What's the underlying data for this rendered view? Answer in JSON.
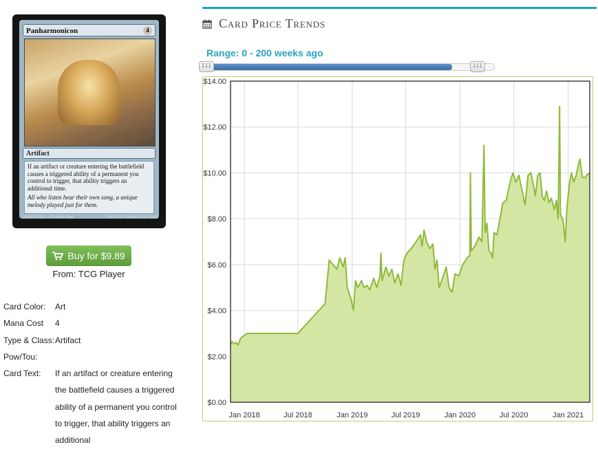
{
  "card": {
    "name": "Panharmonicon",
    "mana_symbol": "4",
    "type_line": "Artifact",
    "rules_text": "If an artifact or creature entering the battlefield causes a triggered ability of a permanent you control to trigger, that ability triggers an additional time.",
    "flavor_text": "All who listen hear their own song, a unique melody played just for them.",
    "collector_line": "226/264 R  KLD · EN  Volkan Baga",
    "copyright": "™ & © 2016 Wizards of the Coast"
  },
  "buy": {
    "label": "Buy for $9.89",
    "from": "From: TCG Player"
  },
  "info": [
    {
      "key": "Card Color:",
      "value": "Art"
    },
    {
      "key": "Mana Cost",
      "value": "4"
    },
    {
      "key": "Type & Class:",
      "value": "Artifact"
    },
    {
      "key": "Pow/Tou:",
      "value": ""
    },
    {
      "key": "Card Text:",
      "value": "If an artifact or creature entering the battlefield causes a triggered ability of a permanent you control to trigger, that ability triggers an additional"
    }
  ],
  "section": {
    "title": "Card Price Trends",
    "icon": "calendar-icon",
    "accent": "#19a6b6"
  },
  "range": {
    "label": "Range: 0 - 200 weeks ago",
    "low": 0,
    "high": 200,
    "max": 200
  },
  "chart_data": {
    "type": "area",
    "title": "",
    "xlabel": "",
    "ylabel": "",
    "ylim": [
      0,
      14
    ],
    "yticks": [
      0,
      2,
      4,
      6,
      8,
      10,
      12,
      14
    ],
    "ytick_labels": [
      "$0.00",
      "$2.00",
      "$4.00",
      "$6.00",
      "$8.00",
      "$10.00",
      "$12.00",
      "$14.00"
    ],
    "xlim": [
      "2017-11-15",
      "2021-03-15"
    ],
    "xticks": [
      "2018-01-01",
      "2018-07-01",
      "2019-01-01",
      "2019-07-01",
      "2020-01-01",
      "2020-07-01",
      "2021-01-01"
    ],
    "xtick_labels": [
      "Jan 2018",
      "Jul 2018",
      "Jan 2019",
      "Jul 2019",
      "Jan 2020",
      "Jul 2020",
      "Jan 2021"
    ],
    "grid": true,
    "colors": {
      "line": "#8fb93a",
      "fill": "#d4e6a3"
    },
    "series": [
      {
        "name": "",
        "points": [
          [
            "2017-11-15",
            2.5
          ],
          [
            "2017-11-20",
            2.65
          ],
          [
            "2017-11-27",
            2.55
          ],
          [
            "2017-12-04",
            2.6
          ],
          [
            "2017-12-10",
            2.5
          ],
          [
            "2017-12-20",
            2.8
          ],
          [
            "2018-01-10",
            3.0
          ],
          [
            "2018-04-15",
            3.0
          ],
          [
            "2018-05-05",
            3.0
          ],
          [
            "2018-07-01",
            3.0
          ],
          [
            "2018-10-01",
            4.3
          ],
          [
            "2018-10-15",
            6.2
          ],
          [
            "2018-11-10",
            5.8
          ],
          [
            "2018-11-20",
            6.3
          ],
          [
            "2018-12-01",
            5.9
          ],
          [
            "2018-12-08",
            6.3
          ],
          [
            "2018-12-15",
            5.0
          ],
          [
            "2018-12-28",
            4.5
          ],
          [
            "2019-01-05",
            4.0
          ],
          [
            "2019-01-12",
            5.3
          ],
          [
            "2019-01-20",
            5.0
          ],
          [
            "2019-02-01",
            5.3
          ],
          [
            "2019-02-10",
            5.0
          ],
          [
            "2019-02-20",
            5.1
          ],
          [
            "2019-03-01",
            4.9
          ],
          [
            "2019-03-15",
            5.4
          ],
          [
            "2019-03-25",
            5.0
          ],
          [
            "2019-04-05",
            5.5
          ],
          [
            "2019-04-08",
            6.5
          ],
          [
            "2019-04-12",
            5.3
          ],
          [
            "2019-04-25",
            5.9
          ],
          [
            "2019-05-05",
            5.5
          ],
          [
            "2019-05-15",
            5.8
          ],
          [
            "2019-05-25",
            5.2
          ],
          [
            "2019-06-05",
            5.6
          ],
          [
            "2019-06-15",
            5.1
          ],
          [
            "2019-06-25",
            6.2
          ],
          [
            "2019-07-05",
            6.5
          ],
          [
            "2019-07-20",
            6.7
          ],
          [
            "2019-08-05",
            7.0
          ],
          [
            "2019-08-20",
            7.3
          ],
          [
            "2019-08-25",
            6.8
          ],
          [
            "2019-09-01",
            7.5
          ],
          [
            "2019-09-10",
            7.0
          ],
          [
            "2019-09-20",
            6.7
          ],
          [
            "2019-10-01",
            6.9
          ],
          [
            "2019-10-08",
            5.8
          ],
          [
            "2019-10-15",
            6.2
          ],
          [
            "2019-10-22",
            5.0
          ],
          [
            "2019-11-05",
            5.5
          ],
          [
            "2019-11-15",
            5.9
          ],
          [
            "2019-11-25",
            5.0
          ],
          [
            "2019-12-05",
            4.8
          ],
          [
            "2019-12-15",
            5.6
          ],
          [
            "2019-12-28",
            5.5
          ],
          [
            "2020-01-10",
            6.0
          ],
          [
            "2020-01-25",
            6.3
          ],
          [
            "2020-02-03",
            6.4
          ],
          [
            "2020-02-05",
            10.0
          ],
          [
            "2020-02-08",
            6.6
          ],
          [
            "2020-02-20",
            6.8
          ],
          [
            "2020-03-05",
            7.2
          ],
          [
            "2020-03-15",
            7.0
          ],
          [
            "2020-03-22",
            11.2
          ],
          [
            "2020-03-26",
            7.4
          ],
          [
            "2020-04-01",
            7.8
          ],
          [
            "2020-04-08",
            6.6
          ],
          [
            "2020-04-15",
            6.5
          ],
          [
            "2020-04-20",
            6.3
          ],
          [
            "2020-04-25",
            7.4
          ],
          [
            "2020-05-05",
            7.3
          ],
          [
            "2020-05-15",
            8.0
          ],
          [
            "2020-05-25",
            8.7
          ],
          [
            "2020-06-05",
            8.8
          ],
          [
            "2020-06-20",
            9.7
          ],
          [
            "2020-06-28",
            10.0
          ],
          [
            "2020-07-08",
            9.6
          ],
          [
            "2020-07-18",
            9.9
          ],
          [
            "2020-07-28",
            9.3
          ],
          [
            "2020-08-08",
            8.6
          ],
          [
            "2020-08-18",
            9.9
          ],
          [
            "2020-08-28",
            10.0
          ],
          [
            "2020-09-05",
            9.5
          ],
          [
            "2020-09-12",
            9.0
          ],
          [
            "2020-09-20",
            9.9
          ],
          [
            "2020-09-28",
            10.0
          ],
          [
            "2020-10-05",
            9.0
          ],
          [
            "2020-10-12",
            8.8
          ],
          [
            "2020-10-20",
            9.2
          ],
          [
            "2020-10-28",
            8.7
          ],
          [
            "2020-11-05",
            8.9
          ],
          [
            "2020-11-15",
            8.4
          ],
          [
            "2020-11-22",
            8.8
          ],
          [
            "2020-11-28",
            8.0
          ],
          [
            "2020-12-03",
            12.9
          ],
          [
            "2020-12-06",
            8.2
          ],
          [
            "2020-12-15",
            7.9
          ],
          [
            "2020-12-22",
            7.0
          ],
          [
            "2020-12-28",
            8.5
          ],
          [
            "2021-01-05",
            9.5
          ],
          [
            "2021-01-12",
            10.0
          ],
          [
            "2021-01-20",
            9.6
          ],
          [
            "2021-01-28",
            9.9
          ],
          [
            "2021-02-05",
            10.4
          ],
          [
            "2021-02-10",
            10.6
          ],
          [
            "2021-02-18",
            9.8
          ],
          [
            "2021-02-28",
            9.8
          ],
          [
            "2021-03-05",
            9.9
          ],
          [
            "2021-03-15",
            10.0
          ]
        ]
      }
    ]
  }
}
